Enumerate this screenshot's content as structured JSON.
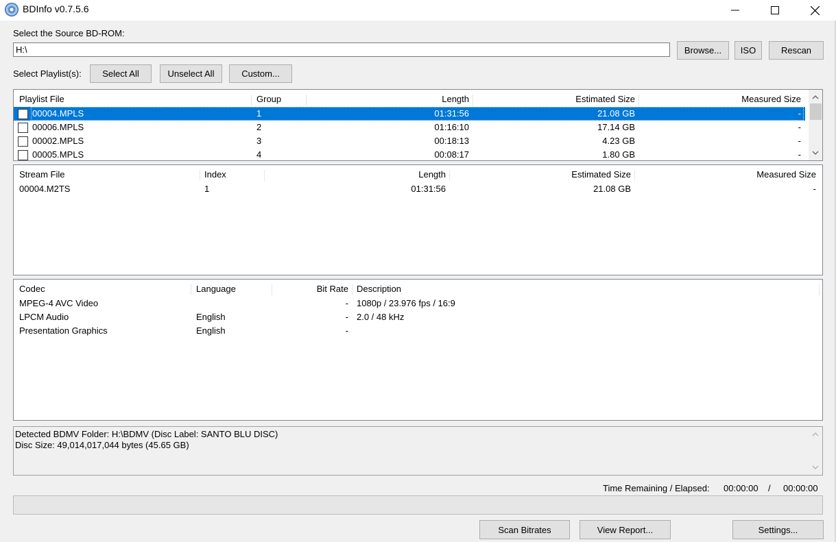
{
  "window": {
    "title": "BDInfo v0.7.5.6"
  },
  "source": {
    "label": "Select the Source BD-ROM:",
    "value": "H:\\",
    "browse": "Browse...",
    "iso": "ISO",
    "rescan": "Rescan"
  },
  "playlist_selector": {
    "label": "Select Playlist(s):",
    "select_all": "Select All",
    "unselect_all": "Unselect All",
    "custom": "Custom..."
  },
  "playlists": {
    "headers": [
      "Playlist File",
      "Group",
      "Length",
      "Estimated Size",
      "Measured Size"
    ],
    "rows": [
      {
        "file": "00004.MPLS",
        "group": "1",
        "length": "01:31:56",
        "est": "21.08 GB",
        "measured": "-",
        "selected": true,
        "checked": false
      },
      {
        "file": "00006.MPLS",
        "group": "2",
        "length": "01:16:10",
        "est": "17.14 GB",
        "measured": "-",
        "selected": false,
        "checked": false
      },
      {
        "file": "00002.MPLS",
        "group": "3",
        "length": "00:18:13",
        "est": "4.23 GB",
        "measured": "-",
        "selected": false,
        "checked": false
      },
      {
        "file": "00005.MPLS",
        "group": "4",
        "length": "00:08:17",
        "est": "1.80 GB",
        "measured": "-",
        "selected": false,
        "checked": false
      }
    ]
  },
  "streams": {
    "headers": [
      "Stream File",
      "Index",
      "Length",
      "Estimated Size",
      "Measured Size"
    ],
    "rows": [
      {
        "file": "00004.M2TS",
        "index": "1",
        "length": "01:31:56",
        "est": "21.08 GB",
        "measured": "-"
      }
    ]
  },
  "codecs": {
    "headers": [
      "Codec",
      "Language",
      "Bit Rate",
      "Description"
    ],
    "rows": [
      {
        "codec": "MPEG-4 AVC Video",
        "language": "",
        "bitrate": "-",
        "desc": "1080p / 23.976 fps / 16:9"
      },
      {
        "codec": "LPCM Audio",
        "language": "English",
        "bitrate": "-",
        "desc": "2.0 / 48 kHz"
      },
      {
        "codec": "Presentation Graphics",
        "language": "English",
        "bitrate": "-",
        "desc": ""
      }
    ]
  },
  "status": {
    "line1": "Detected BDMV Folder: H:\\BDMV (Disc Label: SANTO BLU DISC)",
    "line2": "Disc Size: 49,014,017,044 bytes (45.65 GB)"
  },
  "timer": {
    "label": "Time Remaining / Elapsed:",
    "remaining": "00:00:00",
    "separator": "/",
    "elapsed": "00:00:00"
  },
  "progress": {
    "fraction": 0
  },
  "actions": {
    "scan_bitrates": "Scan Bitrates",
    "view_report": "View Report...",
    "settings": "Settings..."
  },
  "icons": {
    "app": "disc-icon",
    "minimize": "minimize-icon",
    "maximize": "maximize-icon",
    "close": "close-icon",
    "scroll_up": "chevron-up-icon",
    "scroll_down": "chevron-down-icon"
  }
}
